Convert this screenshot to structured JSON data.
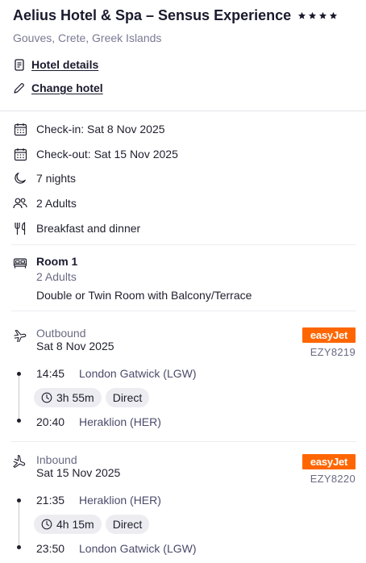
{
  "hotel": {
    "name": "Aelius Hotel & Spa – Sensus Experience",
    "star_count": 4,
    "location": "Gouves, Crete, Greek Islands"
  },
  "links": {
    "details": "Hotel details",
    "change": "Change hotel"
  },
  "stay": {
    "check_in": "Check-in: Sat 8 Nov 2025",
    "check_out": "Check-out: Sat 15 Nov 2025",
    "nights": "7 nights",
    "guests": "2 Adults",
    "board": "Breakfast and dinner"
  },
  "room": {
    "title": "Room 1",
    "guests": "2 Adults",
    "type": "Double or Twin Room with Balcony/Terrace"
  },
  "flights": {
    "outbound": {
      "label": "Outbound",
      "date": "Sat 8 Nov 2025",
      "airline": "easyJet",
      "flight_number": "EZY8219",
      "depart_time": "14:45",
      "depart_airport": "London Gatwick (LGW)",
      "duration": "3h 55m",
      "stops": "Direct",
      "arrive_time": "20:40",
      "arrive_airport": "Heraklion (HER)"
    },
    "inbound": {
      "label": "Inbound",
      "date": "Sat 15 Nov 2025",
      "airline": "easyJet",
      "flight_number": "EZY8220",
      "depart_time": "21:35",
      "depart_airport": "Heraklion (HER)",
      "duration": "4h 15m",
      "stops": "Direct",
      "arrive_time": "23:50",
      "arrive_airport": "London Gatwick (LGW)"
    }
  },
  "icons": {
    "stars": "star-icon",
    "details": "document-icon",
    "change": "pencil-icon",
    "calendar": "calendar-icon",
    "nights": "moon-icon",
    "guests": "people-icon",
    "board": "cutlery-icon",
    "room": "bed-icon",
    "outbound": "plane-takeoff-icon",
    "inbound": "plane-landing-icon",
    "duration": "clock-icon"
  },
  "colors": {
    "airline_brand": "#ff6600",
    "text": "#1f1f2e",
    "muted": "#6a6a84",
    "chip_bg": "#ececf1"
  }
}
